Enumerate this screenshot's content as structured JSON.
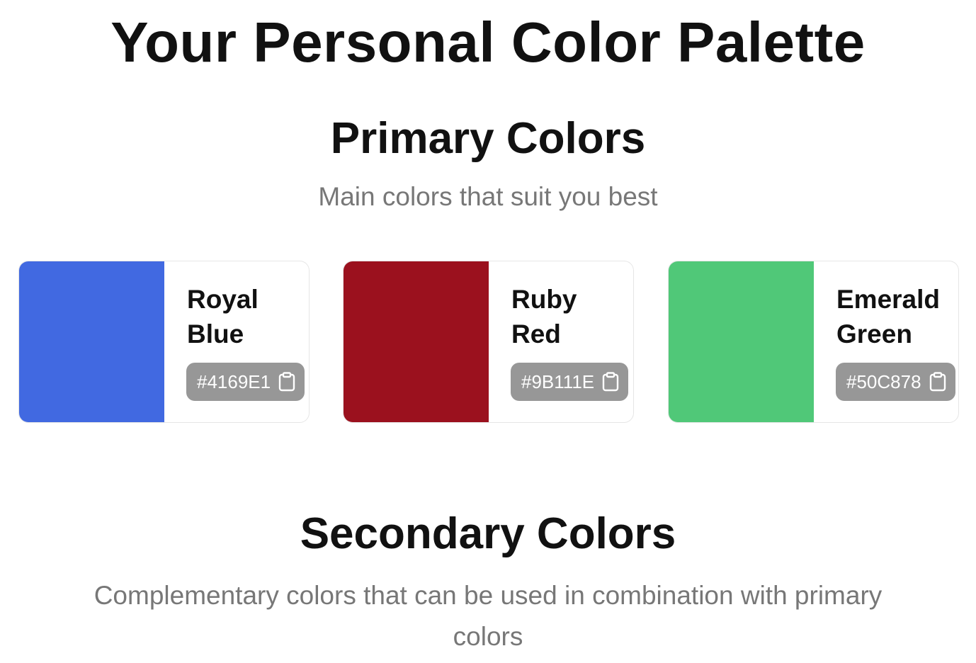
{
  "page": {
    "title": "Your Personal Color Palette"
  },
  "primary": {
    "title": "Primary Colors",
    "subtitle": "Main colors that suit you best",
    "colors": [
      {
        "name": "Royal Blue",
        "hex": "#4169E1",
        "swatch_color": "#4169E1",
        "copy_icon": "clipboard-icon"
      },
      {
        "name": "Ruby Red",
        "hex": "#9B111E",
        "swatch_color": "#9B111E",
        "copy_icon": "clipboard-icon"
      },
      {
        "name": "Emerald Green",
        "hex": "#50C878",
        "swatch_color": "#50C878",
        "copy_icon": "clipboard-icon"
      }
    ]
  },
  "secondary": {
    "title": "Secondary Colors",
    "subtitle": "Complementary colors that can be used in combination with primary colors"
  },
  "theme": {
    "chip_background": "#979797",
    "subtitle_color": "#777777",
    "heading_color": "#111111"
  }
}
